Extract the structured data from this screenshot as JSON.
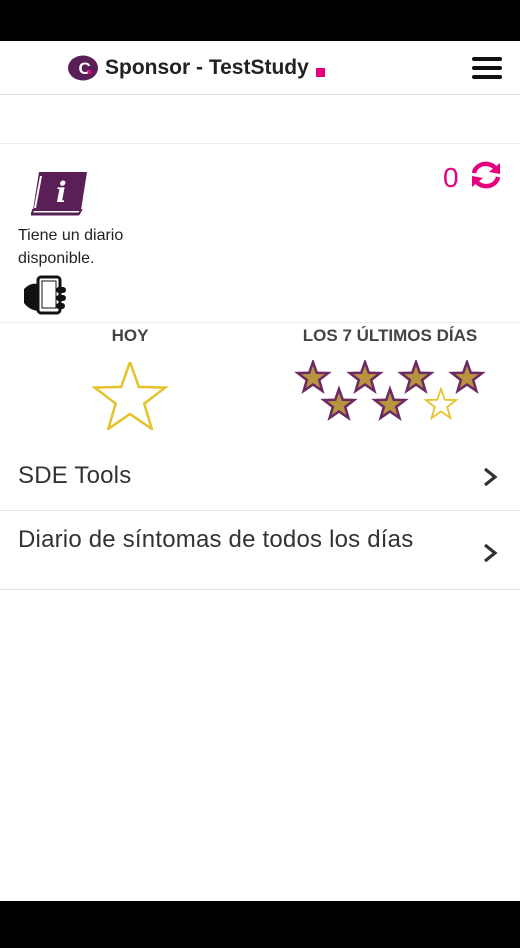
{
  "header": {
    "title": "Sponsor - TestStudy",
    "logo_letter": "C",
    "menu_icon": "hamburger-menu-icon",
    "accent_color": "#e6007e",
    "brand_color": "#5a1f57"
  },
  "diary_panel": {
    "message": "Tiene un diario disponible.",
    "diary_icon": "diary-info-book-icon",
    "device_icon": "hand-holding-tablet-icon",
    "count": "0",
    "refresh_icon": "refresh-sync-icon"
  },
  "progress": {
    "today_label": "HOY",
    "week_label": "LOS 7 ÚLTIMOS DÍAS",
    "today_completed": false,
    "week_days": [
      true,
      true,
      true,
      true,
      true,
      true,
      false
    ],
    "star_outline_color": "#e6c229",
    "star_filled_color": "#b7943e",
    "star_stroke_color": "#6b2a63"
  },
  "menu": {
    "items": [
      {
        "label": "SDE Tools",
        "icon": "chevron-right-icon"
      },
      {
        "label": "Diario de síntomas de todos los días",
        "icon": "chevron-right-icon"
      }
    ]
  }
}
